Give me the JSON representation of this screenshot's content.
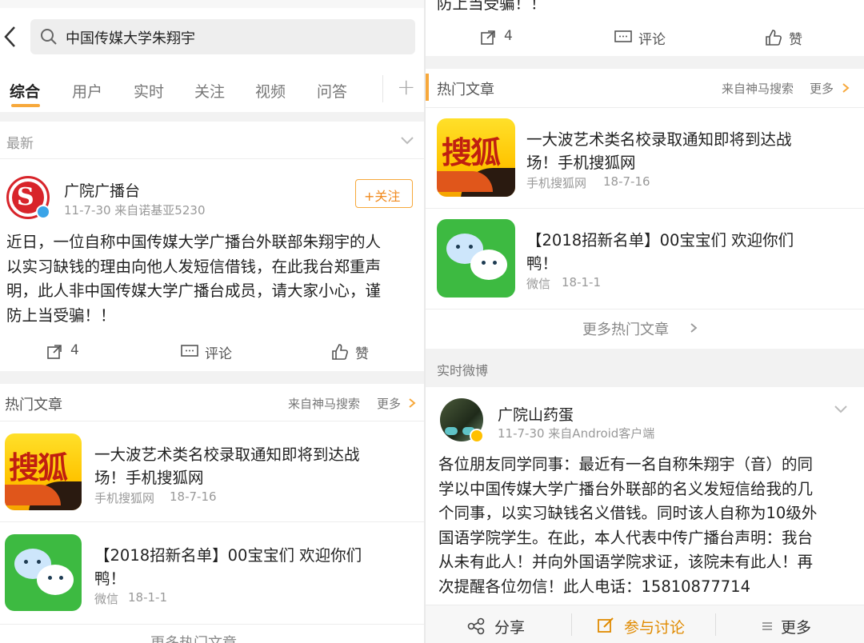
{
  "search": {
    "query": "中国传媒大学朱翔宇"
  },
  "tabs": [
    {
      "label": "综合",
      "active": true
    },
    {
      "label": "用户"
    },
    {
      "label": "实时"
    },
    {
      "label": "关注"
    },
    {
      "label": "视频"
    },
    {
      "label": "问答"
    }
  ],
  "tab_add": "+",
  "latest_section": {
    "title": "最新"
  },
  "post1": {
    "author": "广院广播台",
    "meta": "11-7-30   来自诺基亚5230",
    "follow_label": "+关注",
    "lines": [
      "近日，一位自称中国传媒大学广播台外联部朱翔宇的人",
      "以实习缺钱的理由向他人发短信借钱，在此我台郑重声",
      "明，此人非中国传媒大学广播台成员，请大家小心，谨",
      "防上当受骗！！"
    ],
    "repost_count": "4",
    "comment_label": "评论",
    "like_label": "赞"
  },
  "hot_articles": {
    "title": "热门文章",
    "source": "来自神马搜索",
    "more": "更多",
    "items": [
      {
        "title_l1": "一大波艺术类名校录取通知即将到达战",
        "title_l2": "场！手机搜狐网",
        "source": "手机搜狐网",
        "date": "18-7-16",
        "thumb": "sohu",
        "thumb_text": "搜狐"
      },
      {
        "title_l1": "【2018招新名单】00宝宝们 欢迎你们",
        "title_l2": "鸭！",
        "source": "微信",
        "date": "18-1-1",
        "thumb": "wechat"
      }
    ],
    "more_articles": "更多热门文章"
  },
  "right_top": {
    "clip_text": "防上当受骗！！",
    "repost_count": "4",
    "comment_label": "评论",
    "like_label": "赞"
  },
  "realtime": {
    "title": "实时微博",
    "post": {
      "author": "广院山药蛋",
      "meta": "11-7-30   来自Android客户端",
      "lines": [
        "各位朋友同学同事：最近有一名自称朱翔宇（音）的同",
        "学以中国传媒大学广播台外联部的名义发短信给我的几",
        "个同事，以实习缺钱名义借钱。同时该人自称为10级外",
        "国语学院学生。在此，本人代表中传广播台声明：我台",
        "从未有此人！并向外国语学院求证，该院未有此人！再",
        "次提醒各位勿信！此人电话：15810877714"
      ]
    },
    "share_label": "分享",
    "discuss_label": "参与讨论",
    "more_label": "更多"
  },
  "colors": {
    "accent_orange": "#f7a83b",
    "discuss_orange": "#e08a00",
    "tab_underline": "#f7a83b",
    "verified_badge": "#ffc000"
  }
}
